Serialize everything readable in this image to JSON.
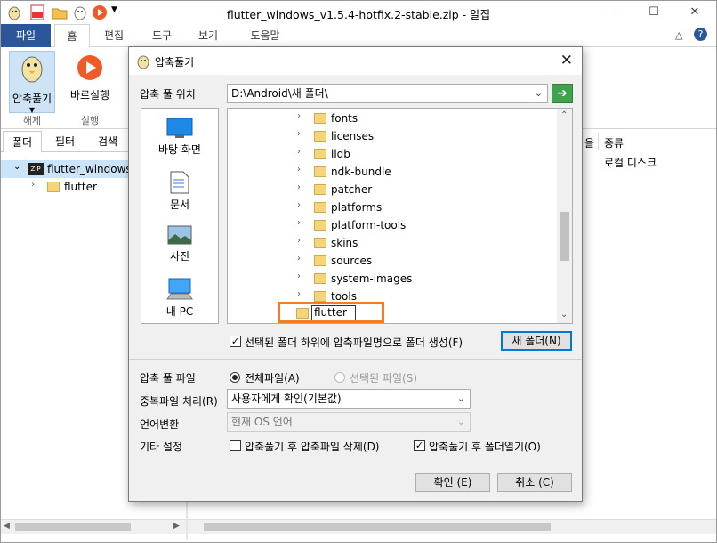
{
  "window": {
    "title": "flutter_windows_v1.5.4-hotfix.2-stable.zip - 알집"
  },
  "ribbon_tabs": {
    "file": "파일",
    "home": "홈",
    "edit": "편집",
    "tools": "도구",
    "view": "보기",
    "help": "도움말"
  },
  "ribbon": {
    "extract_label": "압축풀기",
    "extract_group": "해제",
    "run_label": "바로실행",
    "run_group": "실행"
  },
  "left_panel": {
    "tabs": [
      "폴더",
      "필터",
      "검색"
    ],
    "tree_root": "flutter_windows_v",
    "tree_child": "flutter",
    "zip_badge": "ZIP"
  },
  "right_panel": {
    "col_partial": "을",
    "col_type": "종류",
    "row_type": "로컬 디스크"
  },
  "dialog": {
    "title": "압축풀기",
    "location_label": "압축 풀 위치",
    "location_value": "D:\\Android\\새 폴더\\",
    "places": [
      "바탕 화면",
      "문서",
      "사진",
      "내 PC"
    ],
    "folders": [
      "fonts",
      "licenses",
      "lldb",
      "ndk-bundle",
      "patcher",
      "platforms",
      "platform-tools",
      "skins",
      "sources",
      "system-images",
      "tools"
    ],
    "new_folder_name": "flutter",
    "create_subfolder_label": "선택된 폴더 하위에 압축파일명으로 폴더 생성(F)",
    "new_folder_button": "새 폴더(N)",
    "files_label": "압축 풀 파일",
    "radio_all": "전체파일(A)",
    "radio_selected": "선택된 파일(S)",
    "dup_label": "중복파일 처리(R)",
    "dup_value": "사용자에게 확인(기본값)",
    "lang_label": "언어변환",
    "lang_value": "현재 OS 언어",
    "etc_label": "기타 설정",
    "delete_after_label": "압축풀기 후 압축파일 삭제(D)",
    "open_after_label": "압축풀기 후 폴더열기(O)",
    "ok_button": "확인 (E)",
    "cancel_button": "취소 (C)"
  },
  "colors": {
    "accent": "#2b579a",
    "highlight": "#f07c28",
    "go_green": "#3fa34d",
    "folder": "#f6d47a"
  }
}
